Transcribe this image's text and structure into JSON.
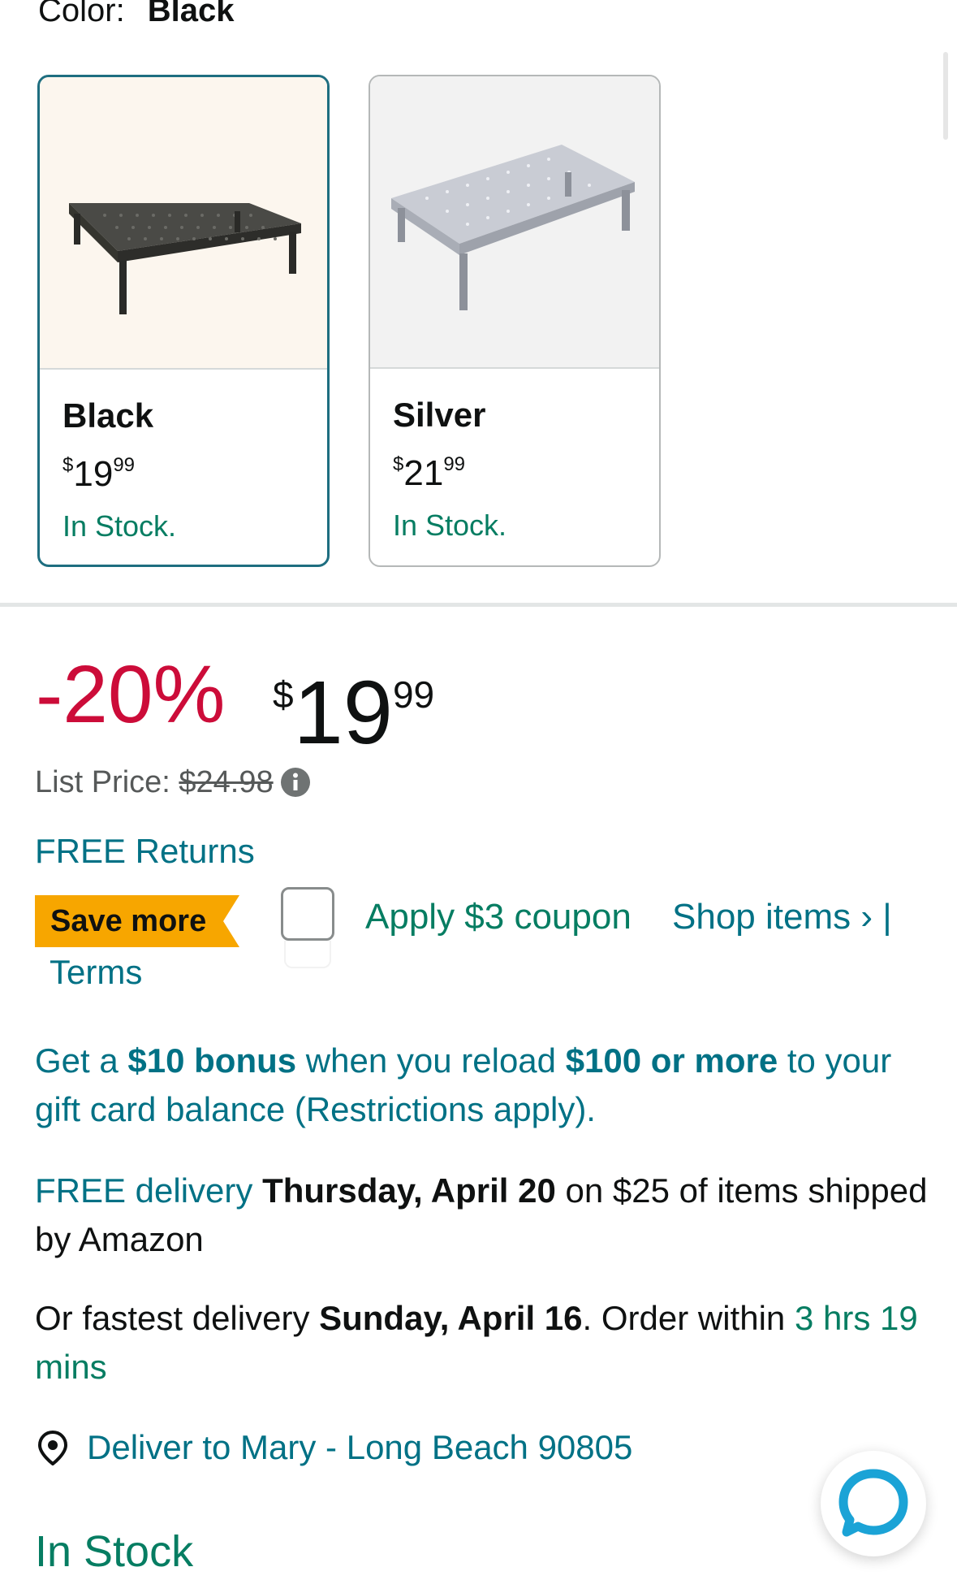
{
  "color_selector": {
    "label": "Color:",
    "value": "Black"
  },
  "swatches": [
    {
      "name": "Black",
      "price_currency": "$",
      "price_whole": "19",
      "price_fraction": "99",
      "stock": "In Stock."
    },
    {
      "name": "Silver",
      "price_currency": "$",
      "price_whole": "21",
      "price_fraction": "99",
      "stock": "In Stock."
    }
  ],
  "price": {
    "discount": "-20%",
    "currency": "$",
    "whole": "19",
    "fraction": "99",
    "list_price_label": "List Price:",
    "list_price_value": "$24.98"
  },
  "free_returns": "FREE Returns",
  "coupon": {
    "badge": "Save more",
    "apply_label": "Apply $3 coupon",
    "shop_items_label": "Shop items ›",
    "separator": "|",
    "terms_label": "Terms"
  },
  "gift_card_promo": {
    "part1": "Get a ",
    "bonus": "$10 bonus",
    "part2": " when you reload ",
    "amount": "$100 or more",
    "part3": " to your gift card balance (Restrictions apply)."
  },
  "delivery": {
    "free_label": "FREE delivery",
    "date": "Thursday, April 20",
    "conditions": " on $25 of items shipped by Amazon",
    "fastest_prefix": "Or fastest delivery ",
    "fastest_date": "Sunday, April 16",
    "order_within": ". Order within ",
    "countdown": "3 hrs 19 mins",
    "deliver_to": "Deliver to Mary - Long Beach 90805"
  },
  "availability": "In Stock",
  "colors": {
    "deal_red": "#cc0c39",
    "link_teal": "#007185",
    "stock_green": "#067d62",
    "selected_border": "#1e6e80",
    "badge_orange": "#f7a600"
  }
}
